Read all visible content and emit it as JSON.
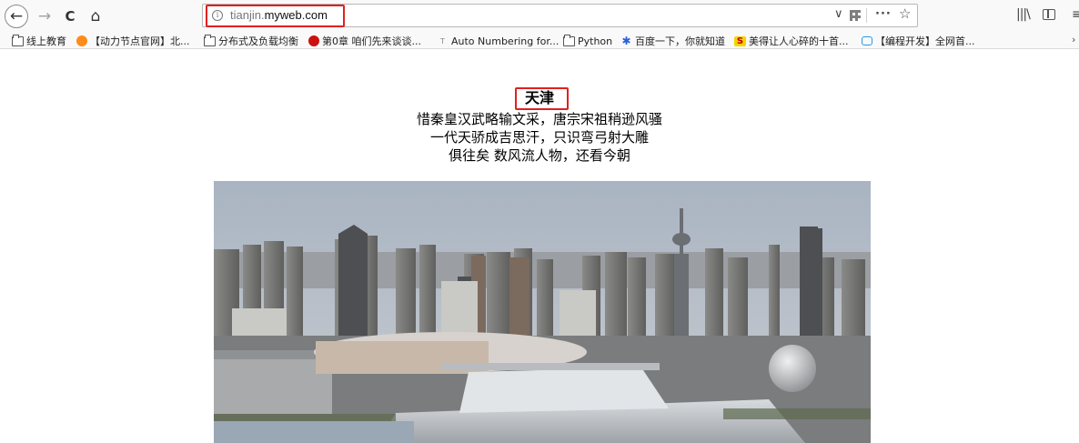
{
  "browser": {
    "url_prefix": "tianjin.",
    "url_domain": "myweb.com",
    "icons": {
      "back": "←",
      "forward": "→",
      "reload": "C",
      "home": "⌂",
      "dropdown": "∨",
      "more": "···",
      "star": "☆",
      "library": "|||\\",
      "menu": "≡",
      "overflow": "›",
      "info": "i"
    }
  },
  "bookmarks": [
    {
      "label": "线上教育",
      "icon": "folder"
    },
    {
      "label": "【动力节点官网】北...",
      "icon": "e-logo"
    },
    {
      "label": "分布式及负载均衡",
      "icon": "folder"
    },
    {
      "label": "第0章 咱们先来谈谈...",
      "icon": "red-logo"
    },
    {
      "label": "Auto Numbering for...",
      "icon": "t-logo"
    },
    {
      "label": "Python",
      "icon": "folder"
    },
    {
      "label": "百度一下，你就知道",
      "icon": "baidu-paw"
    },
    {
      "label": "美得让人心碎的十首...",
      "icon": "s-logo"
    },
    {
      "label": "【编程开发】全网首...",
      "icon": "bilibili-tv"
    }
  ],
  "page": {
    "title": "天津",
    "poem": [
      "惜秦皇汉武略输文采，唐宗宋祖稍逊风骚",
      "一代天骄成吉思汗，只识弯弓射大雕",
      "俱往矣 数风流人物，还看今朝"
    ]
  },
  "colors": {
    "highlight": "#e02020",
    "sky_top": "#a9b4c2",
    "sky_bottom": "#c9ccd0"
  }
}
